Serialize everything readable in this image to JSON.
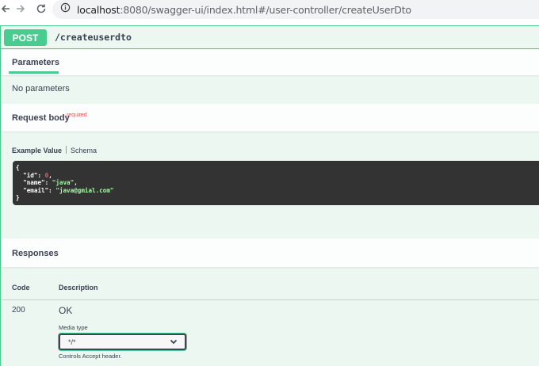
{
  "browser": {
    "url_host": "localhost",
    "url_rest": ":8080/swagger-ui/index.html#/user-controller/createUserDto"
  },
  "operation": {
    "method": "POST",
    "path": "/createuserdto"
  },
  "parameters": {
    "tab_label": "Parameters",
    "empty_text": "No parameters"
  },
  "request_body": {
    "title": "Request body",
    "required_label": "required",
    "tab_example": "Example Value",
    "tab_schema": "Schema",
    "example": {
      "open": "{",
      "id_key": "\"id\"",
      "id_val": "0",
      "name_key": "\"name\"",
      "name_val": "\"java\"",
      "email_key": "\"email\"",
      "email_val": "\"java@gmial.com\"",
      "close": "}"
    }
  },
  "responses": {
    "title": "Responses",
    "col_code": "Code",
    "col_description": "Description",
    "rows": [
      {
        "code": "200",
        "description": "OK",
        "media_type_label": "Media type",
        "media_type_value": "*/*",
        "controls_text": "Controls Accept header."
      }
    ]
  },
  "colors": {
    "post_green": "#49cc90",
    "opblock_bg": "#ebf7f0",
    "code_bg": "#333333",
    "required_red": "#ff4f4f"
  }
}
